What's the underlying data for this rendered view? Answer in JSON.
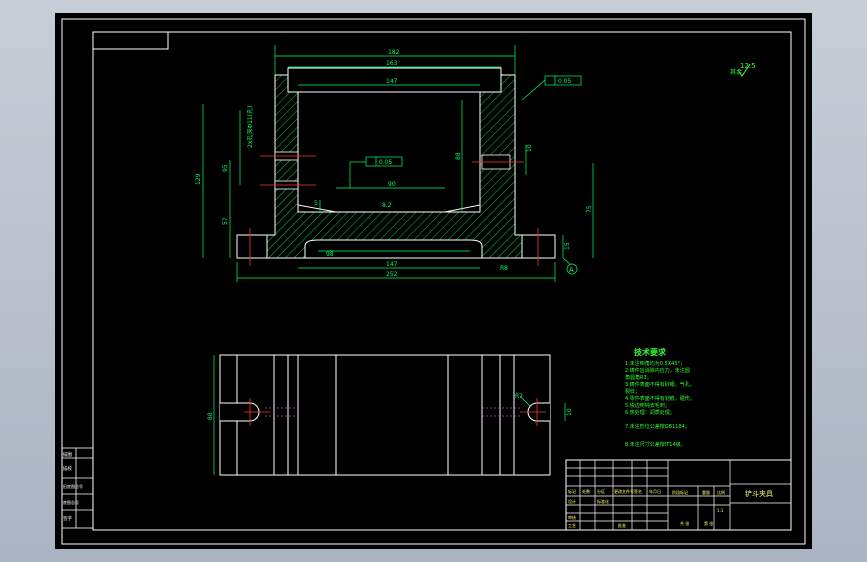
{
  "colors": {
    "background": "#aab4c2",
    "paper": "#000000",
    "line": "#ffffff",
    "outline": "#00ff00",
    "dimension": "#00ff66",
    "centerline": "#ff3333",
    "hidden": "#cc44cc",
    "text_green": "#33ff33",
    "text_yellow": "#ffff66"
  },
  "drawing": {
    "surface_finish": "12.5",
    "surface_finish_note": "其余",
    "datum_label": "A",
    "dims": {
      "top_overall": "182",
      "top_inner_outer": "163",
      "top_inner": "147",
      "bottom_inner": "147",
      "bottom_overall": "252",
      "bottom_slot": "98",
      "middle": "90",
      "left_height": "129",
      "left_upper": "95",
      "left_lower": "57",
      "right_height": "75",
      "right_mid": "88",
      "right_hole": "10",
      "right_bottom": "15",
      "center_small": "8.2",
      "tolerance_top": "0.05",
      "tolerance_center": "0.05",
      "hole_note": "2x孔深Φ11(孔)",
      "bottom_radius": "R8",
      "small_5": "5",
      "side_view_height": "88",
      "side_view_r": "R7",
      "side_view_10": "10"
    }
  },
  "tech_req": {
    "title": "技术要求",
    "lines": [
      "1.未注倒角均为0.5X45°；",
      "2.铸件应消除内应力，未注圆",
      "角圆角R3；",
      "3.铸件表面不得有砂眼，气孔，",
      "裂纹；",
      "4.零件表面不得有划痕，碰伤；",
      "5.锐边倒钝去毛刺；",
      "6.热处理：调质处理；",
      "7.未注形位公差按GB1184；",
      "8.未注尺寸公差按IT14级。"
    ]
  },
  "title_block": {
    "part_name": "铲斗夹具",
    "scale": "1:1",
    "labels": [
      "标记",
      "处数",
      "分区",
      "更改文件号",
      "签名",
      "年月日"
    ],
    "row2": [
      "设计",
      "",
      "标准化",
      "",
      "阶段标记",
      "重量",
      "比例"
    ],
    "row3": [
      "审核",
      "",
      "",
      "",
      "",
      "",
      ""
    ],
    "row4": [
      "工艺",
      "",
      "批准",
      "",
      "共 张",
      "第 张"
    ]
  },
  "side_labels": [
    "描图",
    "描校",
    "旧底图总号",
    "底图总号",
    "签字"
  ]
}
